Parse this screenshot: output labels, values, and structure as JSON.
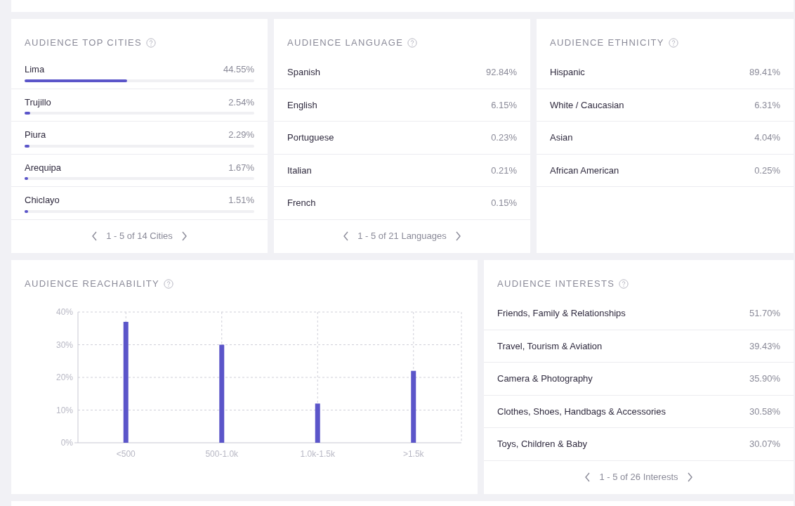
{
  "cities": {
    "title": "AUDIENCE TOP CITIES",
    "items": [
      {
        "name": "Lima",
        "value": "44.55%",
        "level": 0.4455
      },
      {
        "name": "Trujillo",
        "value": "2.54%",
        "level": 0.0254
      },
      {
        "name": "Piura",
        "value": "2.29%",
        "level": 0.0229
      },
      {
        "name": "Arequipa",
        "value": "1.67%",
        "level": 0.0167
      },
      {
        "name": "Chiclayo",
        "value": "1.51%",
        "level": 0.0151
      }
    ],
    "pager": "1 - 5 of 14 Cities"
  },
  "language": {
    "title": "AUDIENCE LANGUAGE",
    "items": [
      {
        "name": "Spanish",
        "value": "92.84%"
      },
      {
        "name": "English",
        "value": "6.15%"
      },
      {
        "name": "Portuguese",
        "value": "0.23%"
      },
      {
        "name": "Italian",
        "value": "0.21%"
      },
      {
        "name": "French",
        "value": "0.15%"
      }
    ],
    "pager": "1 - 5 of 21 Languages"
  },
  "ethnicity": {
    "title": "AUDIENCE ETHNICITY",
    "items": [
      {
        "name": "Hispanic",
        "value": "89.41%"
      },
      {
        "name": "White / Caucasian",
        "value": "6.31%"
      },
      {
        "name": "Asian",
        "value": "4.04%"
      },
      {
        "name": "African American",
        "value": "0.25%"
      }
    ]
  },
  "reachability": {
    "title": "AUDIENCE REACHABILITY",
    "chart_data": {
      "type": "bar",
      "categories": [
        "<500",
        "500-1.0k",
        "1.0k-1.5k",
        ">1.5k"
      ],
      "values": [
        37,
        30,
        12,
        22
      ],
      "grid": true,
      "ylim": [
        0,
        40
      ],
      "yticks": [
        {
          "value": 0,
          "label": "0%"
        },
        {
          "value": 10,
          "label": "10%"
        },
        {
          "value": 20,
          "label": "20%"
        },
        {
          "value": 30,
          "label": "30%"
        },
        {
          "value": 40,
          "label": "40%"
        }
      ]
    }
  },
  "interests": {
    "title": "AUDIENCE INTERESTS",
    "items": [
      {
        "name": "Friends, Family & Relationships",
        "value": "51.70%"
      },
      {
        "name": "Travel, Tourism & Aviation",
        "value": "39.43%"
      },
      {
        "name": "Camera & Photography",
        "value": "35.90%"
      },
      {
        "name": "Clothes, Shoes, Handbags & Accessories",
        "value": "30.58%"
      },
      {
        "name": "Toys, Children & Baby",
        "value": "30.07%"
      }
    ],
    "pager": "1 - 5 of 26 Interests"
  }
}
